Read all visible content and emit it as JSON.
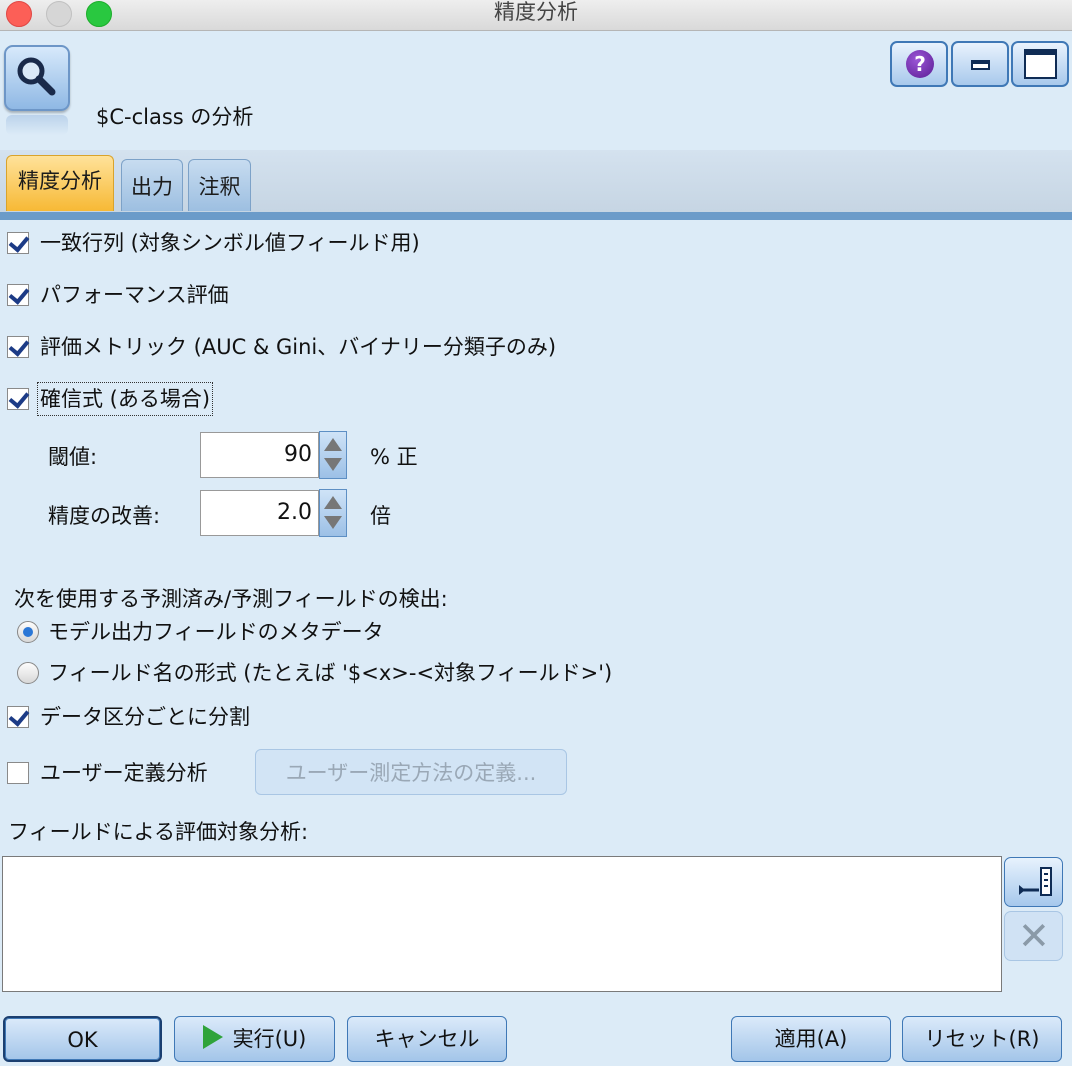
{
  "window": {
    "title": "精度分析"
  },
  "header": {
    "node_name": "$C-class の分析",
    "node_icon": "magnifier-icon"
  },
  "tabs": [
    {
      "label": "精度分析",
      "active": true
    },
    {
      "label": "出力",
      "active": false
    },
    {
      "label": "注釈",
      "active": false
    }
  ],
  "options": {
    "coincidence_matrix": "一致行列 (対象シンボル値フィールド用)",
    "performance_eval": "パフォーマンス評価",
    "eval_metrics": "評価メトリック (AUC & Gini、バイナリー分類子のみ)",
    "confidence": "確信式 (ある場合)"
  },
  "threshold": {
    "label": "閾値:",
    "value": "90",
    "unit": "% 正"
  },
  "improvement": {
    "label": "精度の改善:",
    "value": "2.0",
    "unit": "倍"
  },
  "detect": {
    "label": "次を使用する予測済み/予測フィールドの検出:",
    "options": [
      {
        "label": "モデル出力フィールドのメタデータ",
        "selected": true
      },
      {
        "label": "フィールド名の形式 (たとえば '$<x>-<対象フィールド>')",
        "selected": false
      }
    ]
  },
  "split_partitions": "データ区分ごとに分割",
  "user_defined": {
    "label": "ユーザー定義分析",
    "button": "ユーザー測定方法の定義..."
  },
  "breakdown": {
    "label": "フィールドによる評価対象分析:"
  },
  "buttons": {
    "ok": "OK",
    "run": "実行(U)",
    "cancel": "キャンセル",
    "apply": "適用(A)",
    "reset": "リセット(R)"
  },
  "colors": {
    "active_tab": "#f7b935",
    "background": "#dcebf7",
    "accent": "#3f78b6"
  }
}
